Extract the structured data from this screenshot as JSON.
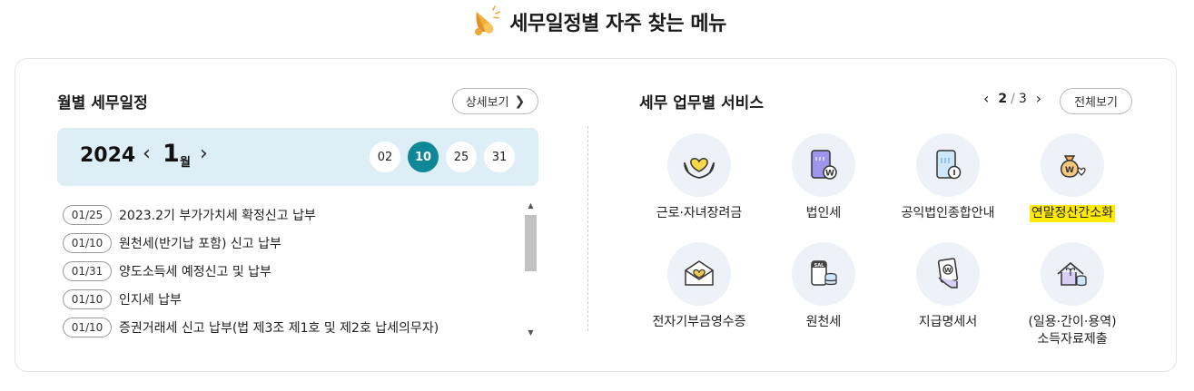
{
  "header": {
    "title": "세무일정별 자주 찾는 메뉴",
    "icon": "megaphone-icon"
  },
  "schedule": {
    "title": "월별 세무일정",
    "detail_label": "상세보기",
    "year": "2024",
    "month": "1",
    "month_unit": "월",
    "days": [
      "02",
      "10",
      "25",
      "31"
    ],
    "active_day": "10",
    "accent": "#0e8796",
    "items": [
      {
        "date": "01/25",
        "text": "2023.2기 부가가치세 확정신고 납부"
      },
      {
        "date": "01/10",
        "text": "원천세(반기납 포함) 신고 납부"
      },
      {
        "date": "01/31",
        "text": "양도소득세 예정신고 및 납부"
      },
      {
        "date": "01/10",
        "text": "인지세 납부"
      },
      {
        "date": "01/10",
        "text": "증권거래세 신고 납부(법 제3조 제1호 및 제2호 납세의무자)"
      }
    ]
  },
  "services": {
    "title": "세무 업무별 서비스",
    "page_current": "2",
    "page_total": "3",
    "all_label": "전체보기",
    "items": [
      {
        "label": "근로·자녀장려금",
        "icon": "heart-hands-icon"
      },
      {
        "label": "법인세",
        "icon": "document-coin-icon"
      },
      {
        "label": "공익법인종합안내",
        "icon": "document-info-icon"
      },
      {
        "label": "연말정산간소화",
        "icon": "money-bag-icon",
        "highlight": "#ffea00"
      },
      {
        "label": "전자기부금영수증",
        "icon": "heart-envelope-icon"
      },
      {
        "label": "원천세",
        "icon": "salary-coins-icon"
      },
      {
        "label": "지급명세서",
        "icon": "hand-document-icon"
      },
      {
        "label": "(일용·간이·용역)",
        "label2": "소득자료제출",
        "icon": "house-coins-icon"
      }
    ]
  }
}
